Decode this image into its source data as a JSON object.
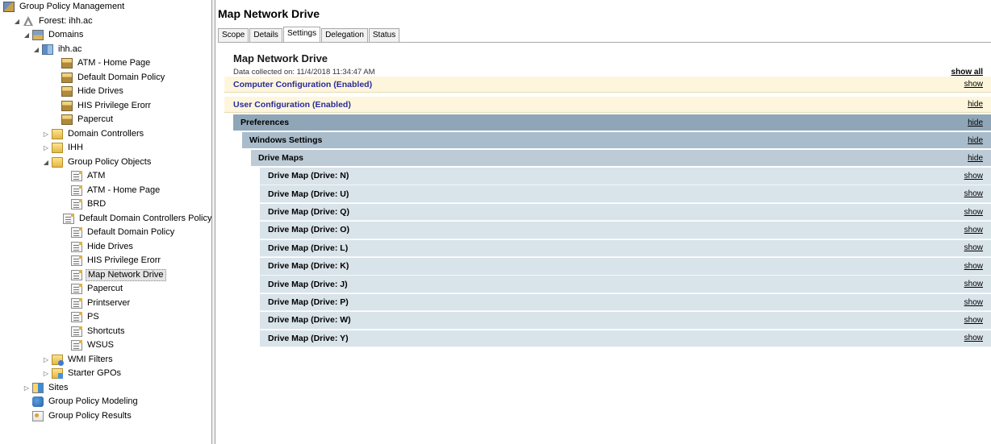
{
  "tree": {
    "items": [
      {
        "label": "Group Policy Management",
        "icon": "gpm-icon",
        "indent": 0,
        "expander": "none",
        "name": "tree-root"
      },
      {
        "label": "Forest: ihh.ac",
        "icon": "forest-icon",
        "indent": 1,
        "expander": "expanded",
        "name": "tree-forest"
      },
      {
        "label": "Domains",
        "icon": "domains-icon",
        "indent": 2,
        "expander": "expanded",
        "name": "tree-domains"
      },
      {
        "label": "ihh.ac",
        "icon": "domain-icon",
        "indent": 3,
        "expander": "expanded",
        "name": "tree-domain"
      },
      {
        "label": "ATM - Home Page",
        "icon": "gpo-link-icon",
        "indent": 5,
        "expander": "none",
        "name": "tree-link-atm-home"
      },
      {
        "label": "Default Domain Policy",
        "icon": "gpo-link-icon",
        "indent": 5,
        "expander": "none",
        "name": "tree-link-default-domain-policy"
      },
      {
        "label": "Hide Drives",
        "icon": "gpo-link-icon",
        "indent": 5,
        "expander": "none",
        "name": "tree-link-hide-drives"
      },
      {
        "label": "HIS Privilege Erorr",
        "icon": "gpo-link-icon",
        "indent": 5,
        "expander": "none",
        "name": "tree-link-his-privilege"
      },
      {
        "label": "Papercut",
        "icon": "gpo-link-icon",
        "indent": 5,
        "expander": "none",
        "name": "tree-link-papercut"
      },
      {
        "label": "Domain Controllers",
        "icon": "ou-icon",
        "indent": 4,
        "expander": "collapsed",
        "name": "tree-domain-controllers"
      },
      {
        "label": "IHH",
        "icon": "ou-icon",
        "indent": 4,
        "expander": "collapsed",
        "name": "tree-ou-ihh"
      },
      {
        "label": "Group Policy Objects",
        "icon": "folder-icon",
        "indent": 4,
        "expander": "expanded",
        "name": "tree-gpo-container"
      },
      {
        "label": "ATM",
        "icon": "gpo-icon",
        "indent": 6,
        "expander": "none",
        "name": "tree-gpo-atm"
      },
      {
        "label": "ATM - Home Page",
        "icon": "gpo-icon",
        "indent": 6,
        "expander": "none",
        "name": "tree-gpo-atm-home"
      },
      {
        "label": "BRD",
        "icon": "gpo-icon",
        "indent": 6,
        "expander": "none",
        "name": "tree-gpo-brd"
      },
      {
        "label": "Default Domain Controllers Policy",
        "icon": "gpo-icon",
        "indent": 6,
        "expander": "none",
        "name": "tree-gpo-default-dc-policy"
      },
      {
        "label": "Default Domain Policy",
        "icon": "gpo-icon",
        "indent": 6,
        "expander": "none",
        "name": "tree-gpo-default-domain-policy"
      },
      {
        "label": "Hide Drives",
        "icon": "gpo-icon",
        "indent": 6,
        "expander": "none",
        "name": "tree-gpo-hide-drives"
      },
      {
        "label": "HIS Privilege Erorr",
        "icon": "gpo-icon",
        "indent": 6,
        "expander": "none",
        "name": "tree-gpo-his-privilege"
      },
      {
        "label": "Map Network Drive",
        "icon": "gpo-icon",
        "indent": 6,
        "expander": "none",
        "name": "tree-gpo-map-network-drive",
        "selected": true
      },
      {
        "label": "Papercut",
        "icon": "gpo-icon",
        "indent": 6,
        "expander": "none",
        "name": "tree-gpo-papercut"
      },
      {
        "label": "Printserver",
        "icon": "gpo-icon",
        "indent": 6,
        "expander": "none",
        "name": "tree-gpo-printserver"
      },
      {
        "label": "PS",
        "icon": "gpo-icon",
        "indent": 6,
        "expander": "none",
        "name": "tree-gpo-ps"
      },
      {
        "label": "Shortcuts",
        "icon": "gpo-icon",
        "indent": 6,
        "expander": "none",
        "name": "tree-gpo-shortcuts"
      },
      {
        "label": "WSUS",
        "icon": "gpo-icon",
        "indent": 6,
        "expander": "none",
        "name": "tree-gpo-wsus"
      },
      {
        "label": "WMI Filters",
        "icon": "wmi-icon",
        "indent": 4,
        "expander": "collapsed",
        "name": "tree-wmi-filters"
      },
      {
        "label": "Starter GPOs",
        "icon": "starter-icon",
        "indent": 4,
        "expander": "collapsed",
        "name": "tree-starter-gpos"
      },
      {
        "label": "Sites",
        "icon": "sites-icon",
        "indent": 2,
        "expander": "collapsed",
        "name": "tree-sites"
      },
      {
        "label": "Group Policy Modeling",
        "icon": "modeling-icon",
        "indent": 2,
        "expander": "none",
        "name": "tree-gp-modeling"
      },
      {
        "label": "Group Policy Results",
        "icon": "results-icon",
        "indent": 2,
        "expander": "none",
        "name": "tree-gp-results"
      }
    ]
  },
  "right": {
    "title": "Map Network Drive",
    "tabs": [
      "Scope",
      "Details",
      "Settings",
      "Delegation",
      "Status"
    ],
    "active_tab": "Settings"
  },
  "report": {
    "title": "Map Network Drive",
    "meta": "Data collected on: 11/4/2018 11:34:47 AM",
    "show_all": "show all",
    "computer_config": {
      "label": "Computer Configuration (Enabled)",
      "link": "show"
    },
    "user_config": {
      "label": "User Configuration (Enabled)",
      "link": "hide"
    },
    "preferences": {
      "label": "Preferences",
      "link": "hide"
    },
    "windows_settings": {
      "label": "Windows Settings",
      "link": "hide"
    },
    "drive_maps": {
      "label": "Drive Maps",
      "link": "hide"
    },
    "drive_map_items": [
      {
        "label": "Drive Map (Drive: N)",
        "link": "show"
      },
      {
        "label": "Drive Map (Drive: U)",
        "link": "show"
      },
      {
        "label": "Drive Map (Drive: Q)",
        "link": "show"
      },
      {
        "label": "Drive Map (Drive: O)",
        "link": "show"
      },
      {
        "label": "Drive Map (Drive: L)",
        "link": "show"
      },
      {
        "label": "Drive Map (Drive: K)",
        "link": "show"
      },
      {
        "label": "Drive Map (Drive: J)",
        "link": "show"
      },
      {
        "label": "Drive Map (Drive: P)",
        "link": "show"
      },
      {
        "label": "Drive Map (Drive: W)",
        "link": "show"
      },
      {
        "label": "Drive Map (Drive: Y)",
        "link": "show"
      }
    ]
  },
  "colors": {
    "config_bg": "#fdf6dc",
    "config_text": "#2a2a9c",
    "preferences_bg": "#8fa6b8",
    "windows_settings_bg": "#a9bccb",
    "drive_maps_bg": "#bccbd6",
    "drive_map_item_bg": "#d9e3ea"
  }
}
